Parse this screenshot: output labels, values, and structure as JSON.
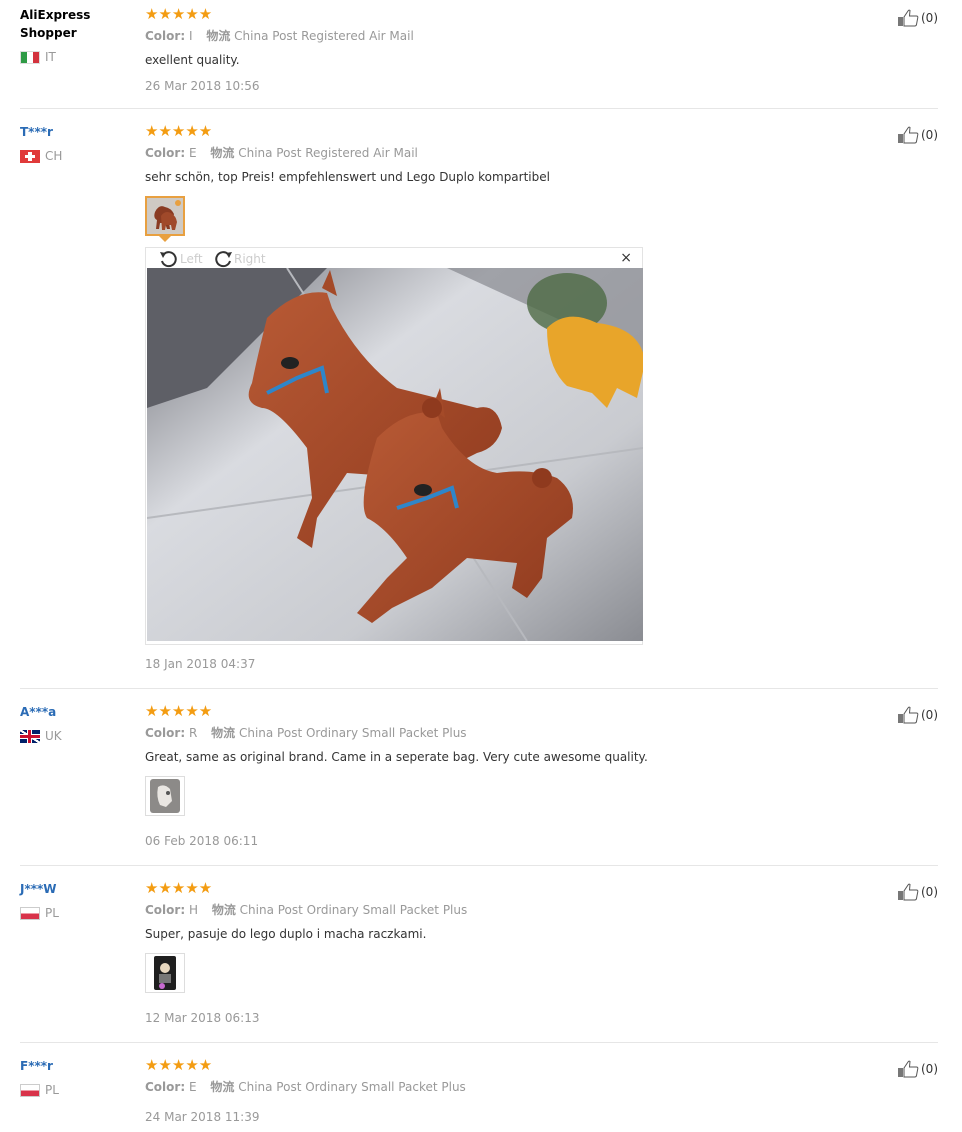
{
  "colors": {
    "star": "#f39c12",
    "username_blue": "#2a6bb5",
    "meta_grey": "#999999",
    "thumb_active": "#e8a040"
  },
  "reviews": [
    {
      "user": "AliExpress Shopper",
      "country": "IT",
      "stars": "★★★★★",
      "color_label": "Color:",
      "color_value": "I",
      "logistics_label": "物流",
      "logistics_value": "China Post Registered Air Mail",
      "text": "exellent quality.",
      "date": "26 Mar 2018 10:56",
      "likes": "(0)"
    },
    {
      "user": "T***r",
      "country": "CH",
      "stars": "★★★★★",
      "color_label": "Color:",
      "color_value": "E",
      "logistics_label": "物流",
      "logistics_value": "China Post Registered Air Mail",
      "text": "sehr schön, top Preis! empfehlenswert und Lego Duplo kompartibel",
      "date": "18 Jan 2018 04:37",
      "likes": "(0)",
      "viewer": {
        "rotate_left": "Left",
        "rotate_right": "Right",
        "close": "×"
      }
    },
    {
      "user": "A***a",
      "country": "UK",
      "stars": "★★★★★",
      "color_label": "Color:",
      "color_value": "R",
      "logistics_label": "物流",
      "logistics_value": "China Post Ordinary Small Packet Plus",
      "text": "Great, same as original brand. Came in a seperate bag. Very cute awesome quality.",
      "date": "06 Feb 2018 06:11",
      "likes": "(0)"
    },
    {
      "user": "J***W",
      "country": "PL",
      "stars": "★★★★★",
      "color_label": "Color:",
      "color_value": "H",
      "logistics_label": "物流",
      "logistics_value": "China Post Ordinary Small Packet Plus",
      "text": "Super, pasuje do lego duplo i macha raczkami.",
      "date": "12 Mar 2018 06:13",
      "likes": "(0)"
    },
    {
      "user": "F***r",
      "country": "PL",
      "stars": "★★★★★",
      "color_label": "Color:",
      "color_value": "E",
      "logistics_label": "物流",
      "logistics_value": "China Post Ordinary Small Packet Plus",
      "date": "24 Mar 2018 11:39",
      "likes": "(0)"
    }
  ]
}
